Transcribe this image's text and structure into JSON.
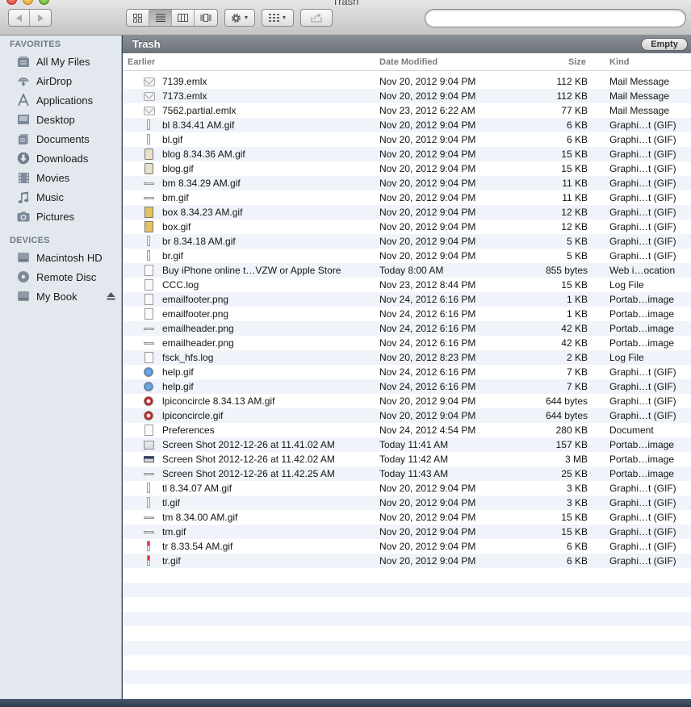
{
  "window": {
    "title": "Trash"
  },
  "toolbar": {
    "back_icon": "left-arrow-icon",
    "forward_icon": "right-arrow-icon",
    "views": [
      "icon-view-icon",
      "list-view-icon",
      "column-view-icon",
      "cover-flow-icon"
    ],
    "search_placeholder": ""
  },
  "sidebar": {
    "favorites_heading": "FAVORITES",
    "favorites": [
      {
        "label": "All My Files",
        "icon": "all-files-icon"
      },
      {
        "label": "AirDrop",
        "icon": "airdrop-icon"
      },
      {
        "label": "Applications",
        "icon": "applications-icon"
      },
      {
        "label": "Desktop",
        "icon": "desktop-icon"
      },
      {
        "label": "Documents",
        "icon": "documents-icon"
      },
      {
        "label": "Downloads",
        "icon": "downloads-icon"
      },
      {
        "label": "Movies",
        "icon": "movies-icon"
      },
      {
        "label": "Music",
        "icon": "music-icon"
      },
      {
        "label": "Pictures",
        "icon": "pictures-icon"
      }
    ],
    "devices_heading": "DEVICES",
    "devices": [
      {
        "label": "Macintosh HD",
        "icon": "hard-drive-icon"
      },
      {
        "label": "Remote Disc",
        "icon": "disc-icon"
      },
      {
        "label": "My Book",
        "icon": "external-drive-icon"
      }
    ]
  },
  "main": {
    "location": "Trash",
    "empty_label": "Empty",
    "columns": {
      "name": "Earlier",
      "date": "Date Modified",
      "size": "Size",
      "kind": "Kind"
    },
    "files": [
      {
        "icon": "mail",
        "name": "7139.emlx",
        "date": "Nov 20, 2012 9:04 PM",
        "size": "112 KB",
        "kind": "Mail Message"
      },
      {
        "icon": "mail",
        "name": "7173.emlx",
        "date": "Nov 20, 2012 9:04 PM",
        "size": "112 KB",
        "kind": "Mail Message"
      },
      {
        "icon": "mail",
        "name": "7562.partial.emlx",
        "date": "Nov 23, 2012 6:22 AM",
        "size": "77 KB",
        "kind": "Mail Message"
      },
      {
        "icon": "thin",
        "name": "bl 8.34.41 AM.gif",
        "date": "Nov 20, 2012 9:04 PM",
        "size": "6 KB",
        "kind": "Graphi…t (GIF)"
      },
      {
        "icon": "thin",
        "name": "bl.gif",
        "date": "Nov 20, 2012 9:04 PM",
        "size": "6 KB",
        "kind": "Graphi…t (GIF)"
      },
      {
        "icon": "blog",
        "name": "blog 8.34.36 AM.gif",
        "date": "Nov 20, 2012 9:04 PM",
        "size": "15 KB",
        "kind": "Graphi…t (GIF)"
      },
      {
        "icon": "blog",
        "name": "blog.gif",
        "date": "Nov 20, 2012 9:04 PM",
        "size": "15 KB",
        "kind": "Graphi…t (GIF)"
      },
      {
        "icon": "line",
        "name": "bm 8.34.29 AM.gif",
        "date": "Nov 20, 2012 9:04 PM",
        "size": "11 KB",
        "kind": "Graphi…t (GIF)"
      },
      {
        "icon": "line",
        "name": "bm.gif",
        "date": "Nov 20, 2012 9:04 PM",
        "size": "11 KB",
        "kind": "Graphi…t (GIF)"
      },
      {
        "icon": "box",
        "name": "box 8.34.23 AM.gif",
        "date": "Nov 20, 2012 9:04 PM",
        "size": "12 KB",
        "kind": "Graphi…t (GIF)"
      },
      {
        "icon": "box",
        "name": "box.gif",
        "date": "Nov 20, 2012 9:04 PM",
        "size": "12 KB",
        "kind": "Graphi…t (GIF)"
      },
      {
        "icon": "thin",
        "name": "br 8.34.18 AM.gif",
        "date": "Nov 20, 2012 9:04 PM",
        "size": "5 KB",
        "kind": "Graphi…t (GIF)"
      },
      {
        "icon": "thin",
        "name": "br.gif",
        "date": "Nov 20, 2012 9:04 PM",
        "size": "5 KB",
        "kind": "Graphi…t (GIF)"
      },
      {
        "icon": "doc",
        "name": "Buy iPhone online t…VZW or Apple Store",
        "date": "Today 8:00 AM",
        "size": "855 bytes",
        "kind": "Web i…ocation"
      },
      {
        "icon": "doc",
        "name": "CCC.log",
        "date": "Nov 23, 2012 8:44 PM",
        "size": "15 KB",
        "kind": "Log File"
      },
      {
        "icon": "doc",
        "name": "emailfooter.png",
        "date": "Nov 24, 2012 6:16 PM",
        "size": "1 KB",
        "kind": "Portab…image"
      },
      {
        "icon": "doc",
        "name": "emailfooter.png",
        "date": "Nov 24, 2012 6:16 PM",
        "size": "1 KB",
        "kind": "Portab…image"
      },
      {
        "icon": "line",
        "name": "emailheader.png",
        "date": "Nov 24, 2012 6:16 PM",
        "size": "42 KB",
        "kind": "Portab…image"
      },
      {
        "icon": "line",
        "name": "emailheader.png",
        "date": "Nov 24, 2012 6:16 PM",
        "size": "42 KB",
        "kind": "Portab…image"
      },
      {
        "icon": "doc",
        "name": "fsck_hfs.log",
        "date": "Nov 20, 2012 8:23 PM",
        "size": "2 KB",
        "kind": "Log File"
      },
      {
        "icon": "round",
        "name": "help.gif",
        "date": "Nov 24, 2012 6:16 PM",
        "size": "7 KB",
        "kind": "Graphi…t (GIF)"
      },
      {
        "icon": "round",
        "name": "help.gif",
        "date": "Nov 24, 2012 6:16 PM",
        "size": "7 KB",
        "kind": "Graphi…t (GIF)"
      },
      {
        "icon": "red",
        "name": "lpiconcircle 8.34.13 AM.gif",
        "date": "Nov 20, 2012 9:04 PM",
        "size": "644 bytes",
        "kind": "Graphi…t (GIF)"
      },
      {
        "icon": "red",
        "name": "lpiconcircle.gif",
        "date": "Nov 20, 2012 9:04 PM",
        "size": "644 bytes",
        "kind": "Graphi…t (GIF)"
      },
      {
        "icon": "doc",
        "name": "Preferences",
        "date": "Nov 24, 2012 4:54 PM",
        "size": "280 KB",
        "kind": "Document"
      },
      {
        "icon": "shot",
        "name": "Screen Shot 2012-12-26 at 11.41.02 AM",
        "date": "Today 11:41 AM",
        "size": "157 KB",
        "kind": "Portab…image"
      },
      {
        "icon": "shot2",
        "name": "Screen Shot 2012-12-26 at 11.42.02 AM",
        "date": "Today 11:42 AM",
        "size": "3 MB",
        "kind": "Portab…image"
      },
      {
        "icon": "line",
        "name": "Screen Shot 2012-12-26 at 11.42.25 AM",
        "date": "Today 11:43 AM",
        "size": "25 KB",
        "kind": "Portab…image"
      },
      {
        "icon": "thin",
        "name": "tl 8.34.07 AM.gif",
        "date": "Nov 20, 2012 9:04 PM",
        "size": "3 KB",
        "kind": "Graphi…t (GIF)"
      },
      {
        "icon": "thin",
        "name": "tl.gif",
        "date": "Nov 20, 2012 9:04 PM",
        "size": "3 KB",
        "kind": "Graphi…t (GIF)"
      },
      {
        "icon": "line",
        "name": "tm 8.34.00 AM.gif",
        "date": "Nov 20, 2012 9:04 PM",
        "size": "15 KB",
        "kind": "Graphi…t (GIF)"
      },
      {
        "icon": "line",
        "name": "tm.gif",
        "date": "Nov 20, 2012 9:04 PM",
        "size": "15 KB",
        "kind": "Graphi…t (GIF)"
      },
      {
        "icon": "tr",
        "name": "tr 8.33.54 AM.gif",
        "date": "Nov 20, 2012 9:04 PM",
        "size": "6 KB",
        "kind": "Graphi…t (GIF)"
      },
      {
        "icon": "tr",
        "name": "tr.gif",
        "date": "Nov 20, 2012 9:04 PM",
        "size": "6 KB",
        "kind": "Graphi…t (GIF)"
      }
    ]
  }
}
